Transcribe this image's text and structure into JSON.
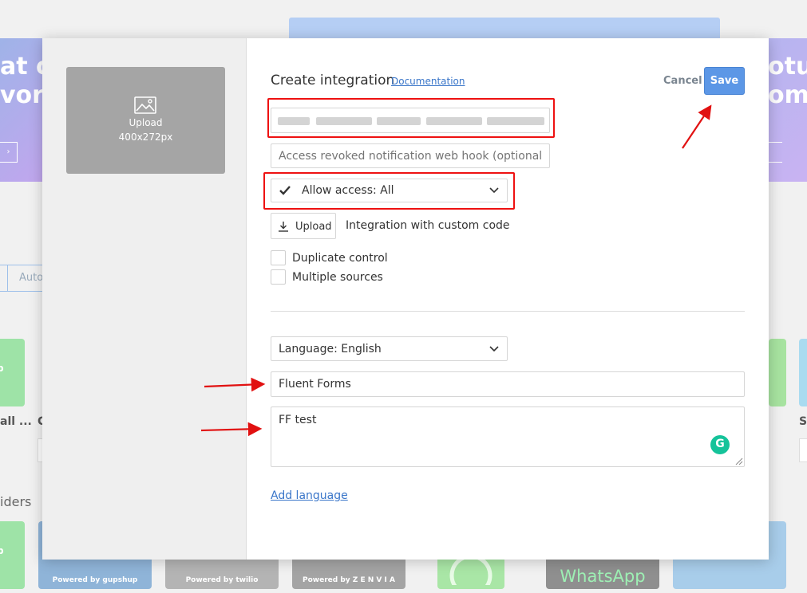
{
  "background": {
    "banner_left_lines": [
      "at o",
      "vorit"
    ],
    "banner_right_lines": [
      "otur",
      "oma"
    ],
    "banner_left_button": "›",
    "tab_label": "Auto",
    "card_labels": [
      "all ...",
      "C",
      "Sh"
    ],
    "section_title": "iders",
    "card_logos": [
      "Powered by gupshup",
      "Powered by twilio",
      "Powered by Z E N V I A",
      "WhatsApp",
      "p",
      "p"
    ]
  },
  "modal": {
    "image_upload": {
      "icon": "image-icon",
      "line1": "Upload",
      "line2": "400x272px"
    },
    "header": {
      "title": "Create integration",
      "documentation_link": "Documentation",
      "cancel_label": "Cancel",
      "save_label": "Save"
    },
    "token_field": {
      "value_redacted": true
    },
    "webhook_field": {
      "placeholder": "Access revoked notification web hook (optional)",
      "value": ""
    },
    "access_select": {
      "checked": true,
      "selected": "Allow access: All"
    },
    "custom_code": {
      "upload_label": "Upload",
      "description": "Integration with custom code"
    },
    "options": [
      {
        "label": "Duplicate control",
        "checked": false
      },
      {
        "label": "Multiple sources",
        "checked": false
      }
    ],
    "language_select": {
      "selected": "Language: English"
    },
    "name_field": {
      "value": "Fluent Forms"
    },
    "description_field": {
      "value": "FF test",
      "grammarly_icon": "G"
    },
    "add_language_link": "Add language"
  },
  "annotation_color": "#e11111"
}
